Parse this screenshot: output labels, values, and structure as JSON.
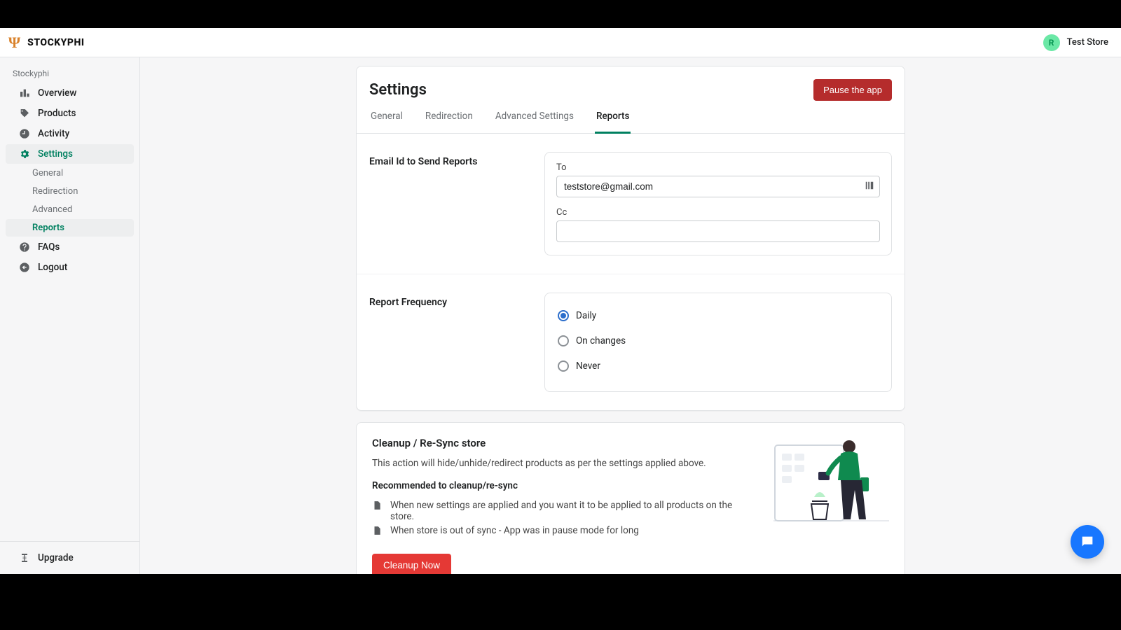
{
  "brand": {
    "name": "STOCKYPHI"
  },
  "header": {
    "avatar_letter": "R",
    "store_name": "Test Store"
  },
  "sidebar": {
    "section_label": "Stockyphi",
    "items": [
      {
        "label": "Overview"
      },
      {
        "label": "Products"
      },
      {
        "label": "Activity"
      },
      {
        "label": "Settings"
      },
      {
        "label": "FAQs"
      },
      {
        "label": "Logout"
      }
    ],
    "settings_sub": [
      {
        "label": "General"
      },
      {
        "label": "Redirection"
      },
      {
        "label": "Advanced"
      },
      {
        "label": "Reports"
      }
    ],
    "footer": {
      "label": "Upgrade"
    }
  },
  "page": {
    "title": "Settings",
    "pause_button": "Pause the app",
    "tabs": [
      {
        "label": "General"
      },
      {
        "label": "Redirection"
      },
      {
        "label": "Advanced Settings"
      },
      {
        "label": "Reports"
      }
    ],
    "email_section": {
      "heading": "Email Id to Send Reports",
      "to_label": "To",
      "to_value": "teststore@gmail.com",
      "cc_label": "Cc",
      "cc_value": ""
    },
    "frequency_section": {
      "heading": "Report Frequency",
      "options": [
        {
          "label": "Daily",
          "checked": true
        },
        {
          "label": "On changes",
          "checked": false
        },
        {
          "label": "Never",
          "checked": false
        }
      ]
    },
    "cleanup": {
      "title": "Cleanup / Re-Sync store",
      "desc": "This action will hide/unhide/redirect products as per the settings applied above.",
      "sub": "Recommended to cleanup/re-sync",
      "bullets": [
        "When new settings are applied and you want it to be applied to all products on the store.",
        "When store is out of sync - App was in pause mode for long"
      ],
      "button": "Cleanup Now"
    }
  }
}
